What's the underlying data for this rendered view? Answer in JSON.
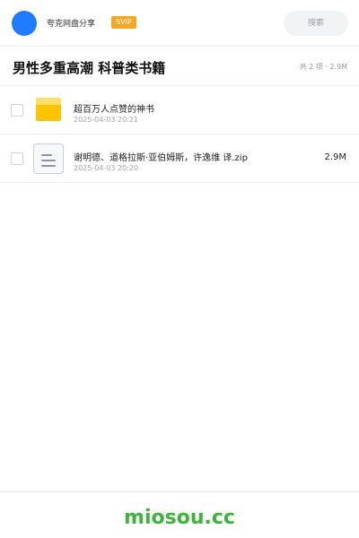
{
  "topbar": {
    "user_name": "夸克网盘分享",
    "badge": "SVIP",
    "search_placeholder": "搜索"
  },
  "header": {
    "title": "男性多重高潮 科普类书籍",
    "summary": "共 2 项 · 2.9M"
  },
  "files": [
    {
      "name": "超百万人点赞的神书",
      "time": "2025-04-03 20:21",
      "size": "",
      "icon": "folder-icon"
    },
    {
      "name": "谢明德、道格拉斯·亚伯姆斯，许逸维 译.zip",
      "time": "2025-04-03 20:20",
      "size": "2.9M",
      "icon": "document-icon"
    }
  ],
  "footer": {
    "watermark": "miosou.cc"
  },
  "colors": {
    "accent": "#1f7bff",
    "badge": "#f5a623",
    "folder": "#ffc400",
    "watermark": "#3cb43c"
  }
}
